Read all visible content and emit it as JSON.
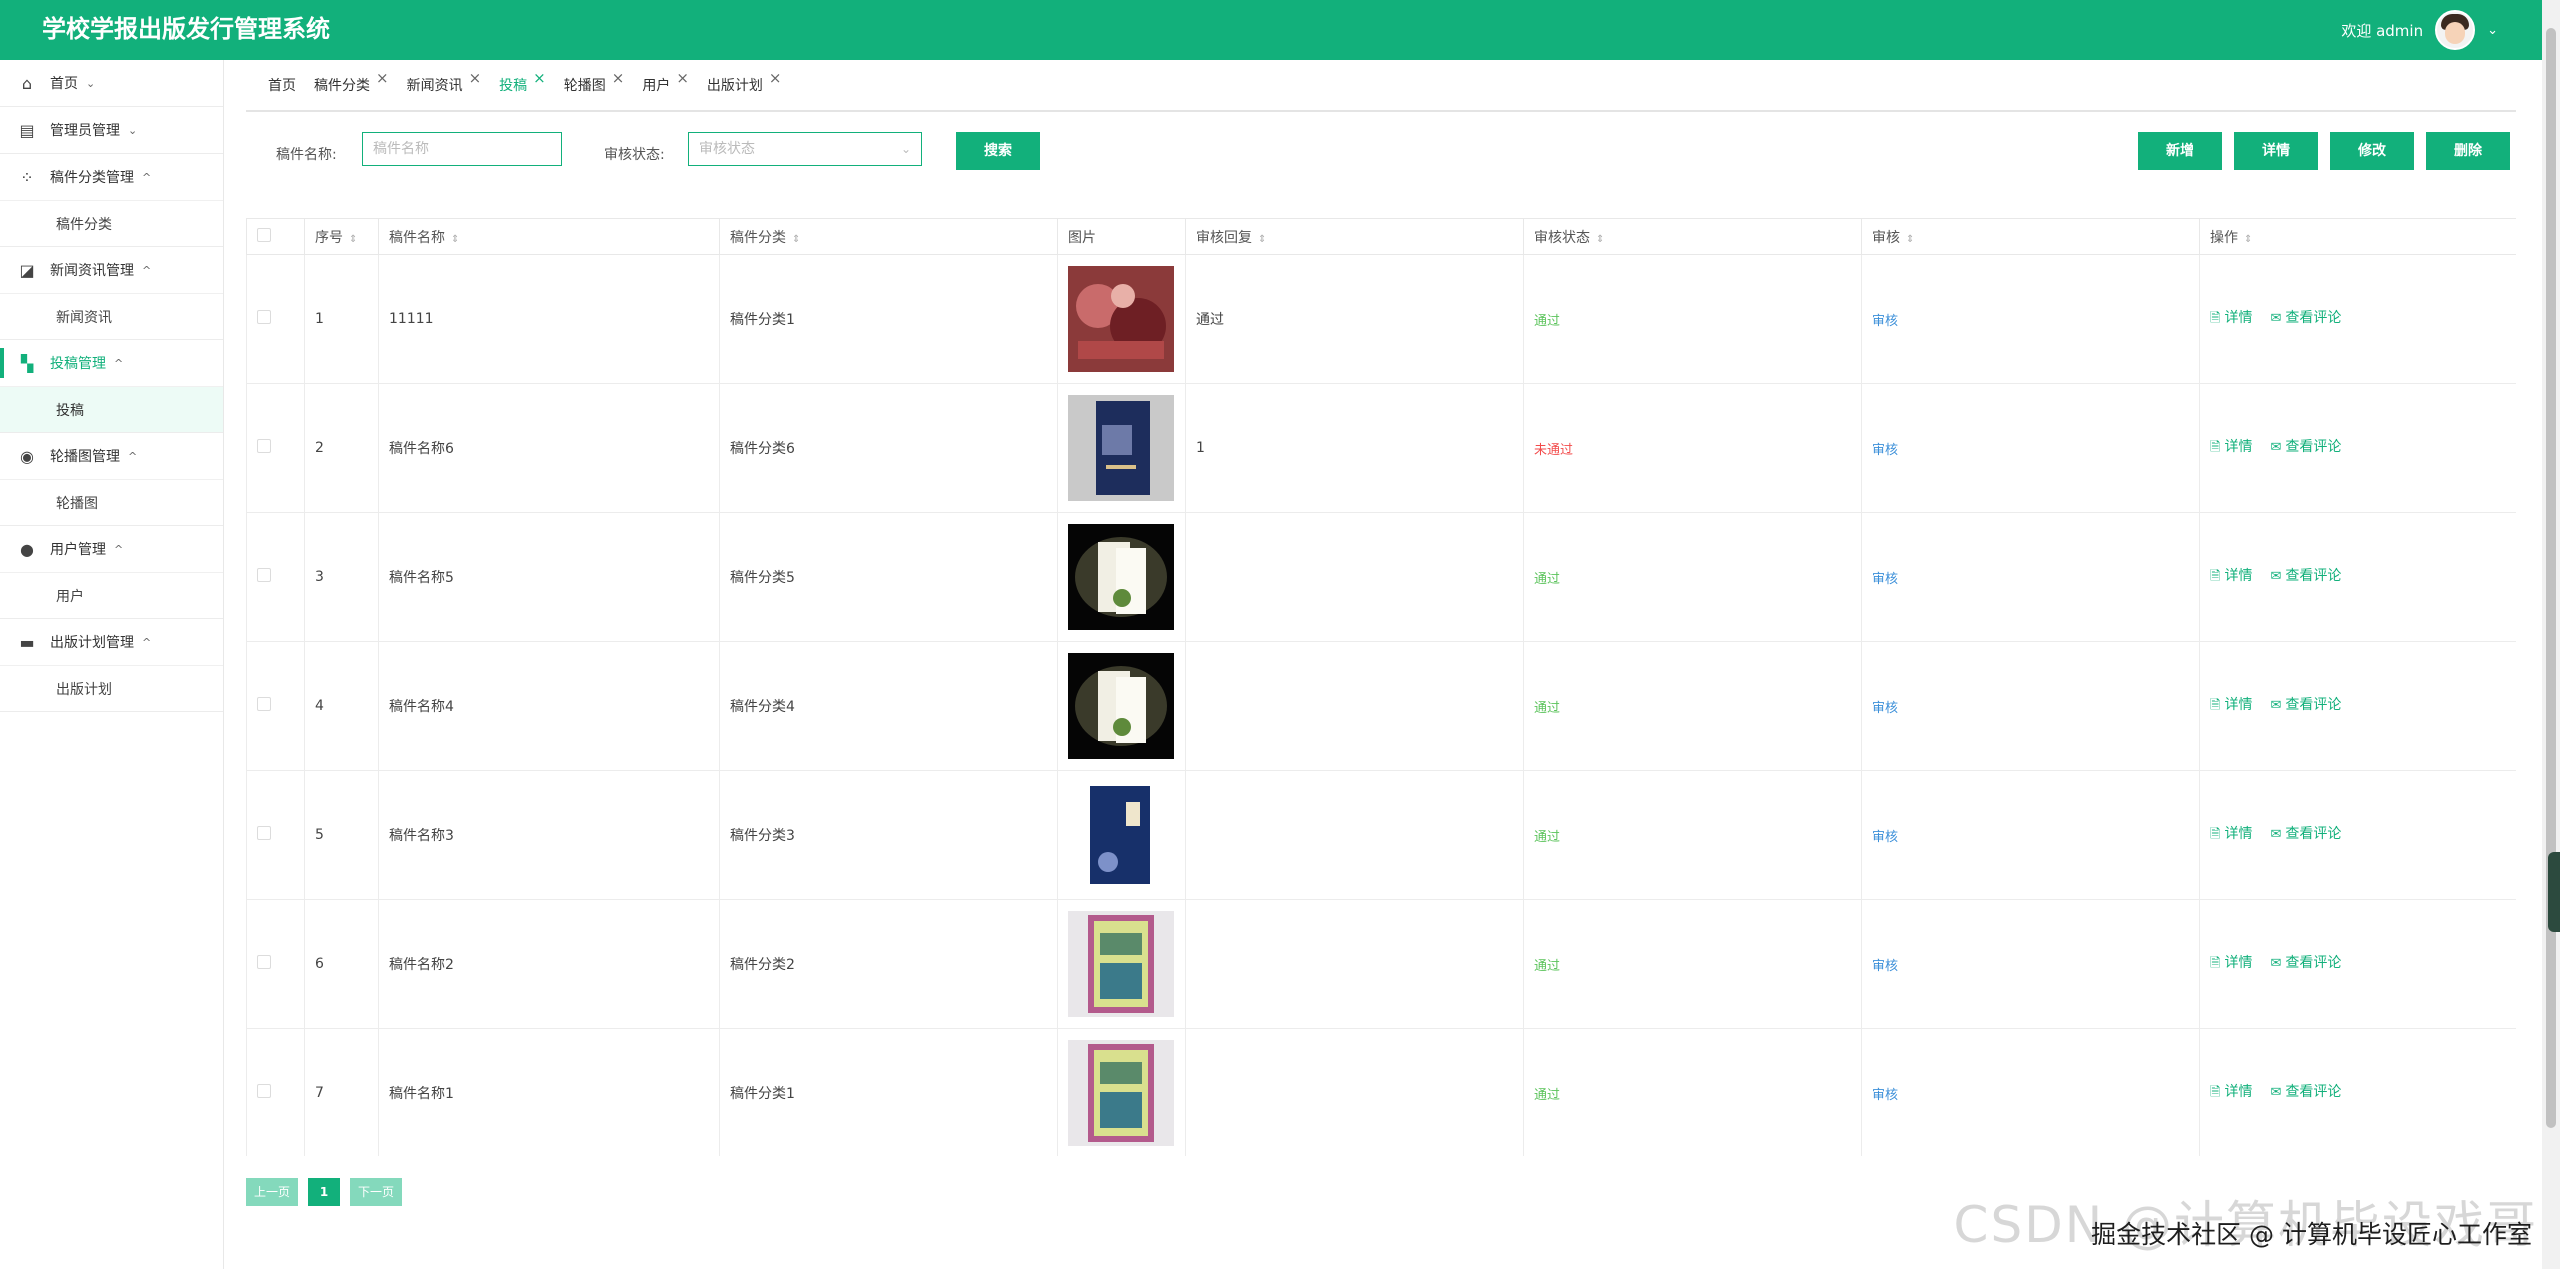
{
  "app": {
    "title": "学校学报出版发行管理系统",
    "welcome": "欢迎 admin"
  },
  "sidebar": {
    "groups": [
      {
        "label": "首页",
        "icon": "home-icon",
        "arrow": "⌄"
      },
      {
        "label": "管理员管理",
        "icon": "admin-icon",
        "arrow": "⌄"
      },
      {
        "label": "稿件分类管理",
        "icon": "category-icon",
        "arrow": "^",
        "sub": "稿件分类"
      },
      {
        "label": "新闻资讯管理",
        "icon": "news-icon",
        "arrow": "^",
        "sub": "新闻资讯"
      },
      {
        "label": "投稿管理",
        "icon": "submission-icon",
        "arrow": "^",
        "sub": "投稿"
      },
      {
        "label": "轮播图管理",
        "icon": "carousel-icon",
        "arrow": "^",
        "sub": "轮播图"
      },
      {
        "label": "用户管理",
        "icon": "user-icon",
        "arrow": "^",
        "sub": "用户"
      },
      {
        "label": "出版计划管理",
        "icon": "plan-icon",
        "arrow": "^",
        "sub": "出版计划"
      }
    ]
  },
  "tabs": [
    "首页",
    "稿件分类",
    "新闻资讯",
    "投稿",
    "轮播图",
    "用户",
    "出版计划"
  ],
  "search": {
    "name_label": "稿件名称:",
    "name_placeholder": "稿件名称",
    "status_label": "审核状态:",
    "status_placeholder": "审核状态",
    "search_btn": "搜索"
  },
  "toolbar": {
    "add": "新增",
    "detail": "详情",
    "edit": "修改",
    "delete": "删除"
  },
  "table": {
    "headers": [
      "序号",
      "稿件名称",
      "稿件分类",
      "图片",
      "审核回复",
      "审核状态",
      "审核",
      "操作"
    ],
    "rows": [
      {
        "no": "1",
        "name": "11111",
        "category": "稿件分类1",
        "reply": "通过",
        "status": "通过",
        "status_type": "pass",
        "review": "审核",
        "thumb": "red-art"
      },
      {
        "no": "2",
        "name": "稿件名称6",
        "category": "稿件分类6",
        "reply": "1",
        "status": "未通过",
        "status_type": "fail",
        "review": "审核",
        "thumb": "navy-book"
      },
      {
        "no": "3",
        "name": "稿件名称5",
        "category": "稿件分类5",
        "reply": "",
        "status": "通过",
        "status_type": "pass",
        "review": "审核",
        "thumb": "dark-book"
      },
      {
        "no": "4",
        "name": "稿件名称4",
        "category": "稿件分类4",
        "reply": "",
        "status": "通过",
        "status_type": "pass",
        "review": "审核",
        "thumb": "dark-book"
      },
      {
        "no": "5",
        "name": "稿件名称3",
        "category": "稿件分类3",
        "reply": "",
        "status": "通过",
        "status_type": "pass",
        "review": "审核",
        "thumb": "blue-book"
      },
      {
        "no": "6",
        "name": "稿件名称2",
        "category": "稿件分类2",
        "reply": "",
        "status": "通过",
        "status_type": "pass",
        "review": "审核",
        "thumb": "ornate-book"
      },
      {
        "no": "7",
        "name": "稿件名称1",
        "category": "稿件分类1",
        "reply": "",
        "status": "通过",
        "status_type": "pass",
        "review": "审核",
        "thumb": "ornate-book"
      }
    ],
    "op_detail": "详情",
    "op_comments": "查看评论"
  },
  "pager": {
    "prev": "上一页",
    "current": "1",
    "next": "下一页"
  },
  "watermark": {
    "overlay": "掘金技术社区 @ 计算机毕设匠心工作室",
    "faint": "CSDN @计算机毕设戏哥"
  },
  "colors": {
    "accent": "#12b07b",
    "pass": "#5bc35b",
    "fail": "#f24b4b",
    "link": "#3b8fd9"
  }
}
